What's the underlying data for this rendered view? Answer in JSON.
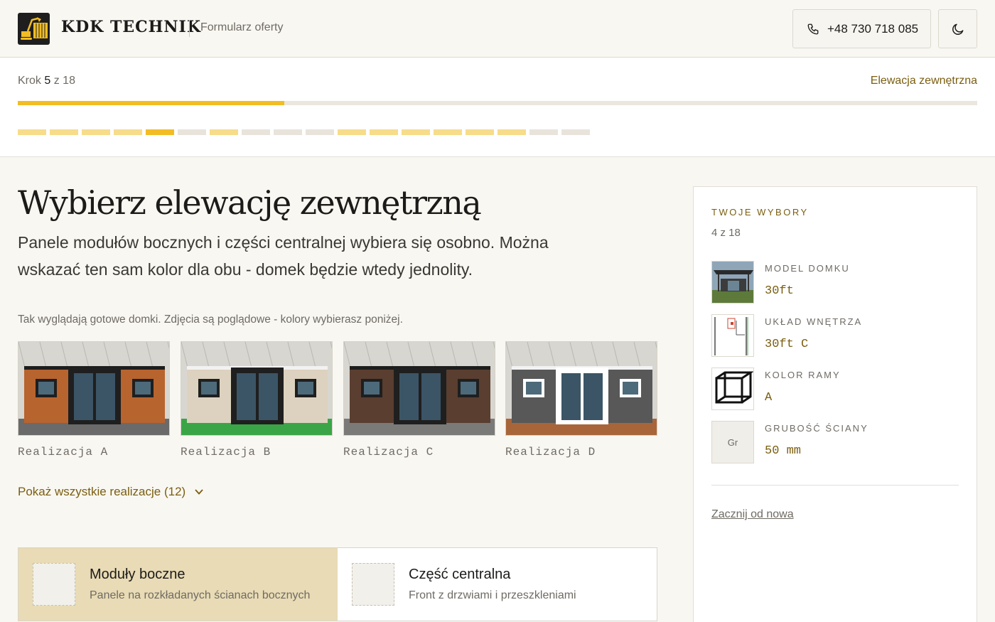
{
  "header": {
    "brand": "KDK TECHNIK",
    "subtitle": "Formularz oferty",
    "phone": "+48 730 718 085",
    "logo_icon": "excavator-container-logo",
    "theme_icon": "moon-icon"
  },
  "progress": {
    "step_prefix": "Krok",
    "step_current": "5",
    "step_suffix": "z 18",
    "step_name": "Elewacja zewnętrzna",
    "fill_fraction": 0.278,
    "segments": [
      "done",
      "done",
      "done",
      "done",
      "current",
      "todo",
      "done",
      "todo",
      "todo",
      "todo",
      "done",
      "done",
      "done",
      "done",
      "done",
      "done",
      "todo",
      "todo"
    ]
  },
  "main": {
    "title": "Wybierz elewację zewnętrzną",
    "lead": "Panele modułów bocznych i części centralnej wybiera się osobno. Można wskazać ten sam kolor dla obu - domek będzie wtedy jednolity.",
    "note": "Tak wyglądają gotowe domki. Zdjęcia są poglądowe - kolory wybierasz poniżej.",
    "gallery": [
      {
        "caption": "Realizacja A",
        "wall": "#b8642e",
        "floor": "#6a6a6a"
      },
      {
        "caption": "Realizacja B",
        "wall": "#ddd2bf",
        "floor": "#3aa547"
      },
      {
        "caption": "Realizacja C",
        "wall": "#5a3e30",
        "floor": "#7a7a78"
      },
      {
        "caption": "Realizacja D",
        "wall": "#585858",
        "floor": "#a8653a"
      }
    ],
    "show_all": "Pokaż wszystkie realizacje (12)",
    "tabs": [
      {
        "title": "Moduły boczne",
        "subtitle": "Panele na rozkładanych ścianach bocznych",
        "active": true
      },
      {
        "title": "Część centralna",
        "subtitle": "Front z drzwiami i przeszkleniami",
        "active": false
      }
    ]
  },
  "sidebar": {
    "heading": "TWOJE WYBORY",
    "count": "4 z 18",
    "choices": [
      {
        "label": "MODEL DOMKU",
        "value": "30ft",
        "icon": "house-photo-thumb"
      },
      {
        "label": "UKŁAD WNĘTRZA",
        "value": "30ft C",
        "icon": "floor-plan-thumb"
      },
      {
        "label": "KOLOR RAMY",
        "value": "A",
        "icon": "frame-cube-thumb"
      },
      {
        "label": "GRUBOŚĆ ŚCIANY",
        "value": "50 mm",
        "thumb_text": "Gr"
      }
    ],
    "reset": "Zacznij od nowa"
  },
  "colors": {
    "accent": "#f2bd24",
    "accent_text": "#7a5e10",
    "active_tab": "#e8dbb5"
  }
}
